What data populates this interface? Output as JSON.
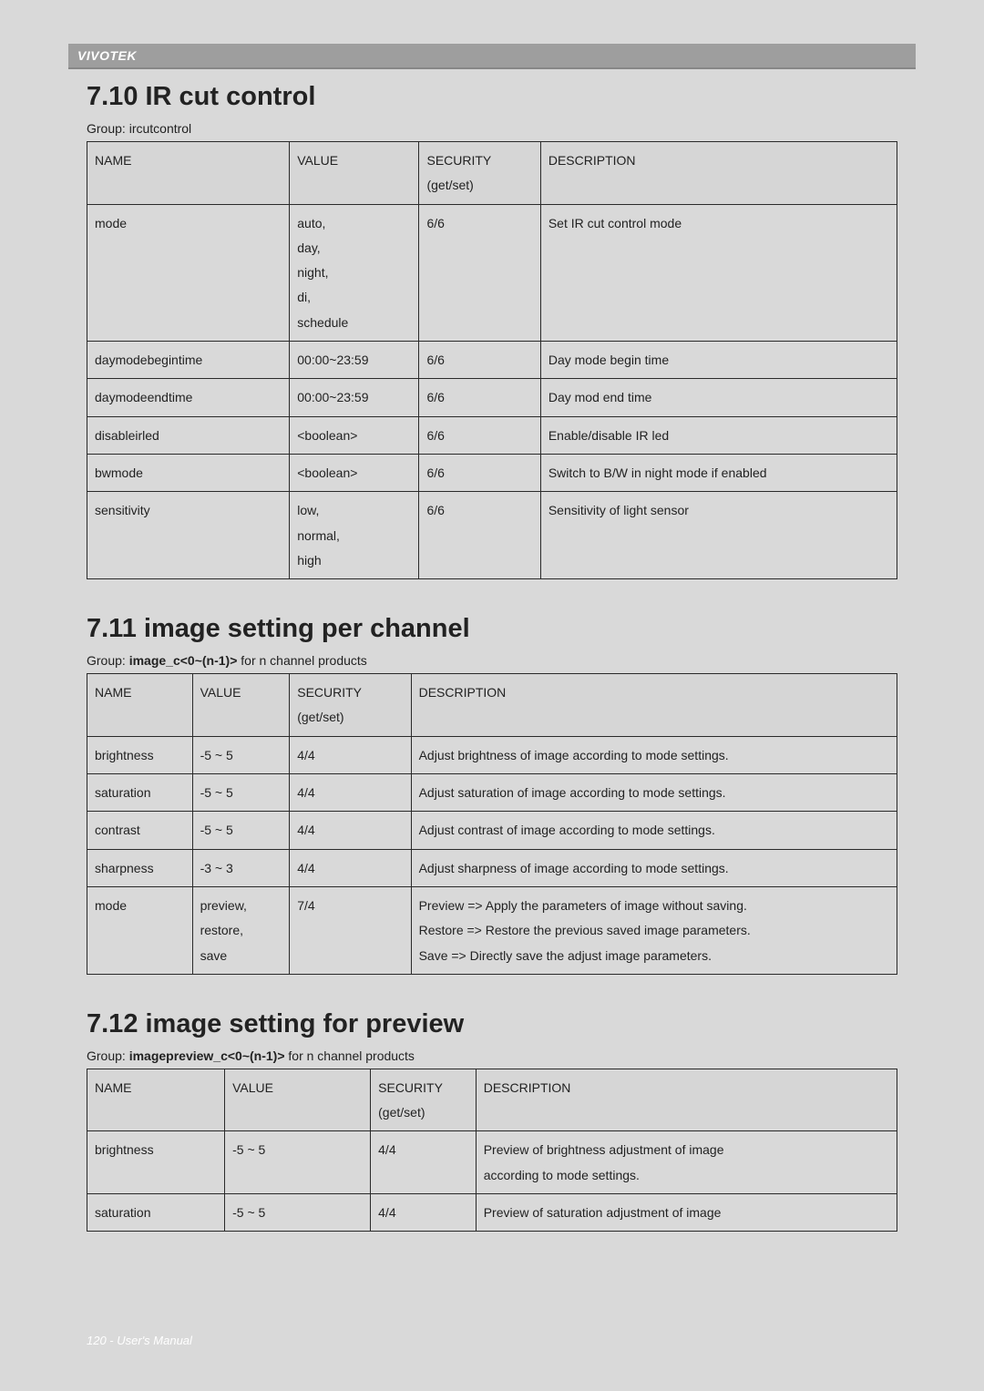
{
  "brand": "VIVOTEK",
  "footer": "120 - User's Manual",
  "sections": [
    {
      "heading": "7.10 IR cut control",
      "group_prefix": "Group: ",
      "group_bold": "",
      "group_suffix": "ircutcontrol",
      "cols": [
        "NAME",
        "VALUE",
        "SECURITY (get/set)",
        "DESCRIPTION"
      ],
      "widths": [
        "25%",
        "16%",
        "15%",
        "44%"
      ],
      "rows": [
        {
          "name": "mode",
          "value": "auto,\nday,\nnight,\ndi,\nschedule",
          "sec": "6/6",
          "desc": "Set IR cut control mode"
        },
        {
          "name": "daymodebegintime",
          "value": "00:00~23:59",
          "sec": "6/6",
          "desc": "Day mode begin time"
        },
        {
          "name": "daymodeendtime",
          "value": "00:00~23:59",
          "sec": "6/6",
          "desc": "Day mod end time"
        },
        {
          "name": "disableirled",
          "value": "<boolean>",
          "sec": "6/6",
          "desc": "Enable/disable IR led"
        },
        {
          "name": "bwmode",
          "value": "<boolean>",
          "sec": "6/6",
          "desc": "Switch to B/W in night mode if enabled"
        },
        {
          "name": "sensitivity",
          "value": "low,\nnormal,\nhigh",
          "sec": "6/6",
          "desc": "Sensitivity of light sensor"
        }
      ]
    },
    {
      "heading": "7.11 image setting per channel",
      "group_prefix": "Group: ",
      "group_bold": "image_c<0~(n-1)>",
      "group_suffix": " for n channel products",
      "cols": [
        "NAME",
        "VALUE",
        "SECURITY (get/set)",
        "DESCRIPTION"
      ],
      "widths": [
        "13%",
        "12%",
        "15%",
        "60%"
      ],
      "rows": [
        {
          "name": "brightness",
          "value": "-5 ~ 5",
          "sec": "4/4",
          "desc": "Adjust brightness of image according to mode settings."
        },
        {
          "name": "saturation",
          "value": "-5 ~ 5",
          "sec": "4/4",
          "desc": "Adjust saturation of image according to mode settings."
        },
        {
          "name": "contrast",
          "value": "-5 ~ 5",
          "sec": "4/4",
          "desc": "Adjust contrast of image according to mode settings."
        },
        {
          "name": "sharpness",
          "value": "-3 ~ 3",
          "sec": "4/4",
          "desc": "Adjust sharpness of image according to mode settings."
        },
        {
          "name": "mode",
          "value": "preview,\nrestore,\nsave",
          "sec": "7/4",
          "desc": "Preview => Apply the parameters of image without saving.\nRestore => Restore the previous saved image parameters.\nSave => Directly save the adjust image parameters."
        }
      ]
    },
    {
      "heading": "7.12 image setting for preview",
      "group_prefix": "Group: ",
      "group_bold": "imagepreview_c<0~(n-1)>",
      "group_suffix": " for n channel products",
      "cols": [
        "NAME",
        "VALUE",
        "SECURITY (get/set)",
        "DESCRIPTION"
      ],
      "widths": [
        "17%",
        "18%",
        "13%",
        "52%"
      ],
      "rows": [
        {
          "name": "brightness",
          "value": "-5 ~ 5",
          "sec": "4/4",
          "desc": "Preview of brightness adjustment of image according to mode settings."
        },
        {
          "name": "saturation",
          "value": "-5 ~ 5",
          "sec": "4/4",
          "desc": "Preview of saturation adjustment of image"
        }
      ]
    }
  ]
}
